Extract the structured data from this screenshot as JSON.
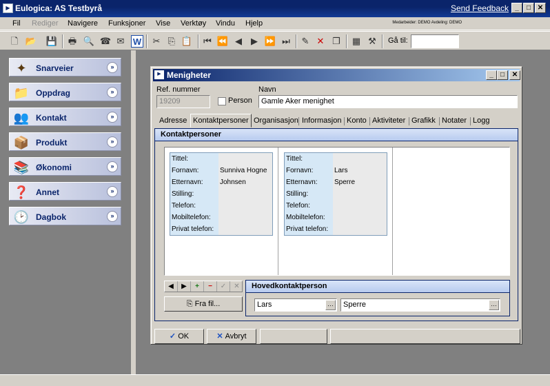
{
  "app": {
    "title": "Eulogica: AS Testbyrå",
    "feedback": "Send Feedback",
    "min": "_",
    "max": "□",
    "close": "✕"
  },
  "menu": {
    "items": [
      "Fil",
      "Rediger",
      "Navigere",
      "Funksjoner",
      "Vise",
      "Verktøy",
      "Vindu",
      "Hjelp"
    ],
    "user_info": "Medarbeider: DEMO   Avdeling: DEMO"
  },
  "toolbar": {
    "goto_label": "Gå til:",
    "goto_value": ""
  },
  "sidebar": {
    "items": [
      {
        "label": "Snarveier",
        "icon": "shortcut-icon"
      },
      {
        "label": "Oppdrag",
        "icon": "folder-icon"
      },
      {
        "label": "Kontakt",
        "icon": "contacts-icon"
      },
      {
        "label": "Produkt",
        "icon": "box-icon"
      },
      {
        "label": "Økonomi",
        "icon": "books-icon"
      },
      {
        "label": "Annet",
        "icon": "question-folder-icon"
      },
      {
        "label": "Dagbok",
        "icon": "clock-folder-icon"
      }
    ],
    "expand_glyph": "»"
  },
  "dialog": {
    "title": "Menigheter",
    "ref_label": "Ref. nummer",
    "ref_value": "19209",
    "person_label": "Person",
    "name_label": "Navn",
    "name_value": "Gamle Aker menighet",
    "tabs": [
      "Adresse",
      "Kontaktpersoner",
      "Organisasjon",
      "Informasjon",
      "Konto",
      "Aktiviteter",
      "Grafikk",
      "Notater",
      "Logg"
    ],
    "active_tab": "Kontaktpersoner",
    "section_title": "Kontaktpersoner",
    "card_fields": [
      "Tittel:",
      "Fornavn:",
      "Etternavn:",
      "Stilling:",
      "Telefon:",
      "Mobiltelefon:",
      "Privat telefon:"
    ],
    "contacts": [
      {
        "values": [
          "",
          "Sunniva Hogne",
          "Johnsen",
          "",
          "",
          "",
          ""
        ]
      },
      {
        "values": [
          "",
          "Lars",
          "Sperre",
          "",
          "",
          "",
          ""
        ]
      }
    ],
    "fra_fil": "Fra fil...",
    "hoved_title": "Hovedkontaktperson",
    "hoved_first": "Lars",
    "hoved_last": "Sperre",
    "ok": "OK",
    "cancel": "Avbryt"
  }
}
